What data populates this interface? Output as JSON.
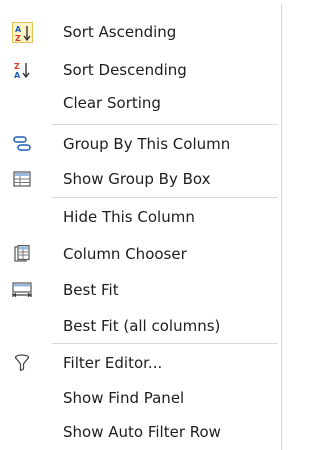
{
  "menu": {
    "items": [
      {
        "label": "Sort Ascending",
        "icon": "sort-ascending-icon"
      },
      {
        "label": "Sort Descending",
        "icon": "sort-descending-icon"
      },
      {
        "label": "Clear Sorting",
        "icon": ""
      },
      {
        "label": "Group By This Column",
        "icon": "group-by-column-icon"
      },
      {
        "label": "Show Group By Box",
        "icon": "group-by-box-icon"
      },
      {
        "label": "Hide This Column",
        "icon": ""
      },
      {
        "label": "Column Chooser",
        "icon": "column-chooser-icon"
      },
      {
        "label": "Best Fit",
        "icon": "best-fit-icon"
      },
      {
        "label": "Best Fit (all columns)",
        "icon": ""
      },
      {
        "label": "Filter Editor...",
        "icon": "filter-editor-icon"
      },
      {
        "label": "Show Find Panel",
        "icon": ""
      },
      {
        "label": "Show Auto Filter Row",
        "icon": ""
      }
    ]
  },
  "colors": {
    "checked_bg": "#fff4c4",
    "checked_border": "#e3c25a",
    "icon_blue": "#1f5fb8",
    "icon_red": "#d23a2a",
    "separator": "#d9d9d9"
  }
}
